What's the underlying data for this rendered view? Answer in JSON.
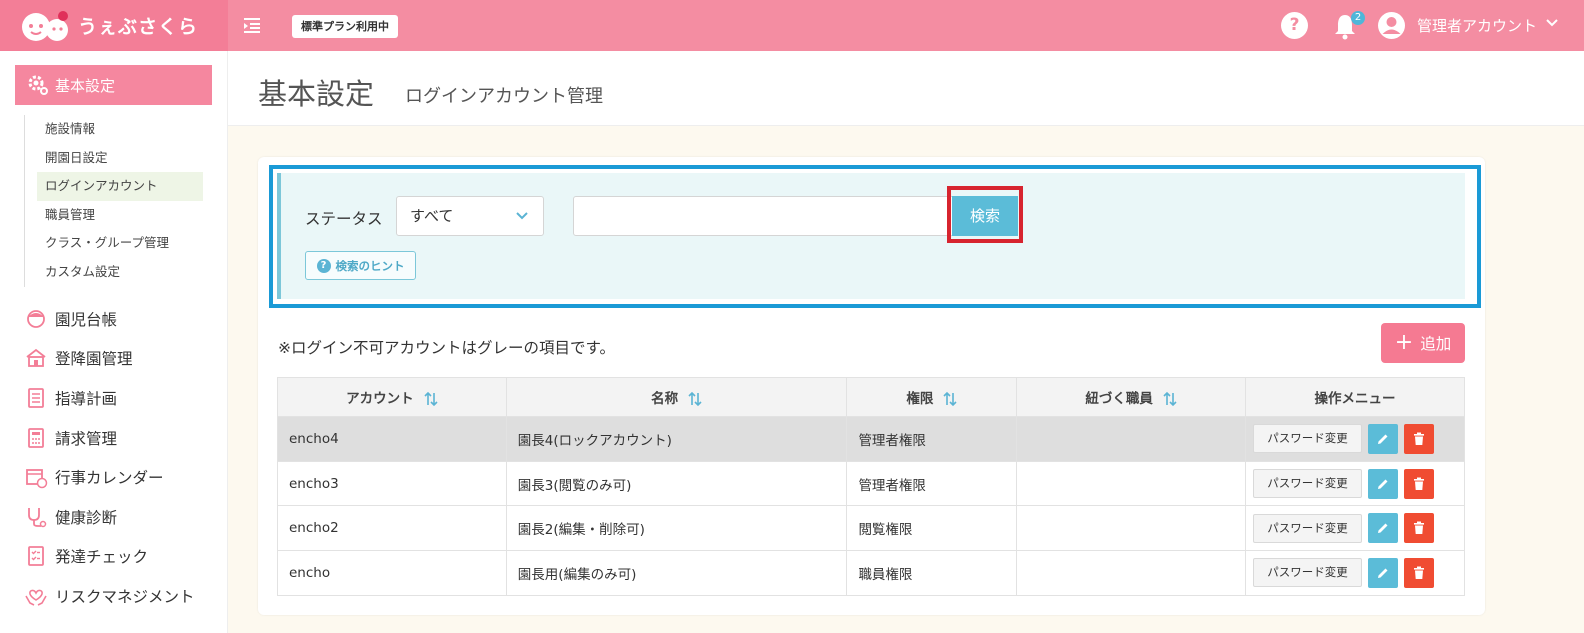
{
  "header": {
    "logo_text": "うぇぶさくら",
    "plan_badge": "標準プラン利用中",
    "help_glyph": "?",
    "notification_count": "2",
    "user_label": "管理者アカウント"
  },
  "sidebar": {
    "active_section": "基本設定",
    "sub_items": [
      "施設情報",
      "開園日設定",
      "ログインアカウント",
      "職員管理",
      "クラス・グループ管理",
      "カスタム設定"
    ],
    "selected_sub": "ログインアカウント",
    "main_items": [
      {
        "label": "園児台帳",
        "icon": "child-icon"
      },
      {
        "label": "登降園管理",
        "icon": "school-icon"
      },
      {
        "label": "指導計画",
        "icon": "notebook-icon"
      },
      {
        "label": "請求管理",
        "icon": "calculator-icon"
      },
      {
        "label": "行事カレンダー",
        "icon": "calendar-icon"
      },
      {
        "label": "健康診断",
        "icon": "stethoscope-icon"
      },
      {
        "label": "発達チェック",
        "icon": "checklist-icon"
      },
      {
        "label": "リスクマネジメント",
        "icon": "hands-heart-icon"
      }
    ]
  },
  "page": {
    "title": "基本設定",
    "subtitle": "ログインアカウント管理"
  },
  "search": {
    "status_label": "ステータス",
    "status_value": "すべて",
    "keyword_value": "",
    "search_button": "検索",
    "hint_button": "検索のヒント"
  },
  "list": {
    "note": "※ログイン不可アカウントはグレーの項目です。",
    "add_button": "追加",
    "columns": [
      "アカウント",
      "名称",
      "権限",
      "紐づく職員",
      "操作メニュー"
    ],
    "rows": [
      {
        "account": "encho4",
        "name": "園長4(ロックアカウント)",
        "role": "管理者権限",
        "staff": "",
        "disabled": true
      },
      {
        "account": "encho3",
        "name": "園長3(閲覧のみ可)",
        "role": "管理者権限",
        "staff": "",
        "disabled": false
      },
      {
        "account": "encho2",
        "name": "園長2(編集・削除可)",
        "role": "閲覧権限",
        "staff": "",
        "disabled": false
      },
      {
        "account": "encho",
        "name": "園長用(編集のみ可)",
        "role": "職員権限",
        "staff": "",
        "disabled": false
      }
    ],
    "password_button": "パスワード変更"
  },
  "colors": {
    "header_pink": "#f48da2",
    "accent_blue": "#5bbcd8",
    "delete_red": "#f04c32",
    "highlight_outline_blue": "#1a9ad6",
    "highlight_outline_red": "#d7242f"
  }
}
